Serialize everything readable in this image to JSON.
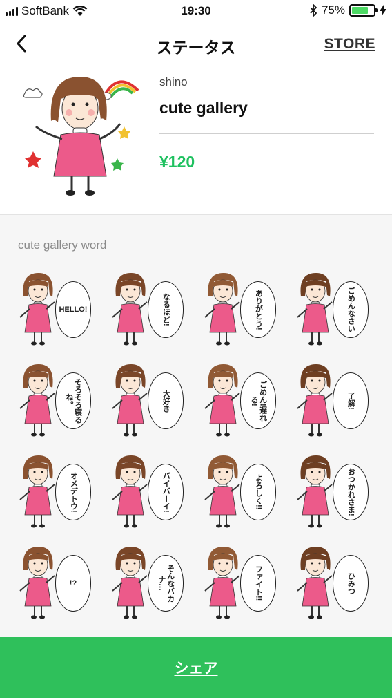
{
  "status_bar": {
    "carrier": "SoftBank",
    "time": "19:30",
    "battery": "75%",
    "battery_level": 0.75,
    "icons": [
      "signal-icon",
      "wifi-icon",
      "bluetooth-icon",
      "battery-icon",
      "charging-icon"
    ]
  },
  "nav": {
    "title": "ステータス",
    "store_label": "STORE"
  },
  "product": {
    "author": "shino",
    "title": "cute gallery",
    "price": "¥120"
  },
  "gallery": {
    "label": "cute gallery word",
    "stickers": [
      {
        "text": "HELLO!"
      },
      {
        "text": "なるほど!"
      },
      {
        "text": "ありがとう!"
      },
      {
        "text": "ごめんなさい"
      },
      {
        "text": "そろそろ寝るね。"
      },
      {
        "text": "大好き"
      },
      {
        "text": "ごめん!遅れる!"
      },
      {
        "text": "了解!"
      },
      {
        "text": "オメデトウ!"
      },
      {
        "text": "バイバーイ!"
      },
      {
        "text": "よろしく!!"
      },
      {
        "text": "おつかれさま!"
      },
      {
        "text": "!?"
      },
      {
        "text": "そんなバカナ…"
      },
      {
        "text": "ファイト!!"
      },
      {
        "text": "ひみつ"
      }
    ]
  },
  "share": {
    "label": "シェア"
  },
  "colors": {
    "accent": "#2fc05b",
    "price": "#1fc160",
    "dress": "#ec5a8a",
    "hair": "#8a5230"
  }
}
